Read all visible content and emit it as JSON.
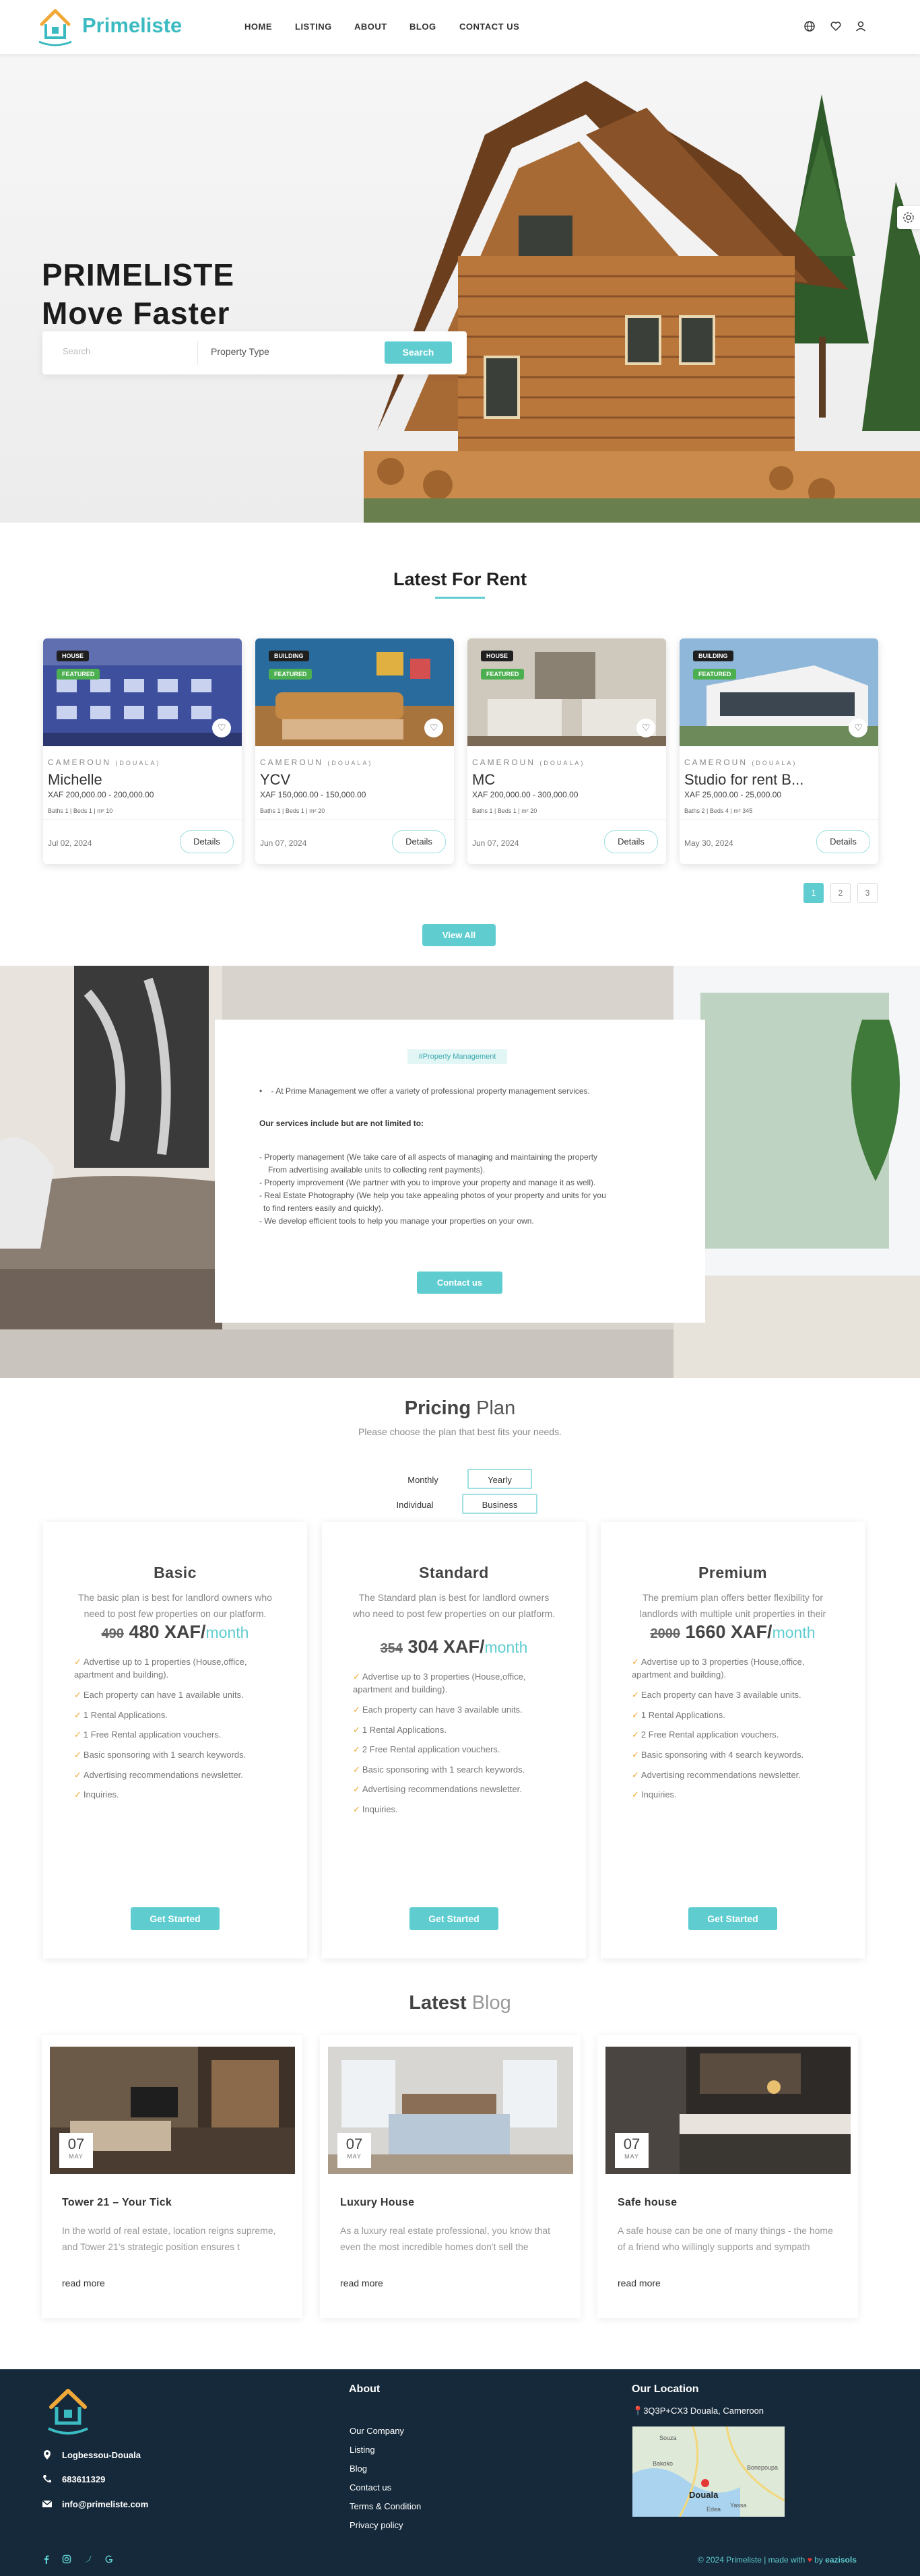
{
  "header": {
    "brand": "Primeliste",
    "nav": [
      "HOME",
      "LISTING",
      "ABOUT",
      "BLOG",
      "CONTACT US"
    ],
    "icons": [
      "globe-icon",
      "heart-icon",
      "user-icon"
    ]
  },
  "hero": {
    "title_line1": "PRIMELISTE",
    "title_line2": "Move Faster",
    "search_placeholder": "Search",
    "property_type": "Property Type",
    "search_button": "Search"
  },
  "rent": {
    "title": "Latest For Rent",
    "cards": [
      {
        "type": "HOUSE",
        "featured": "FEATURED",
        "location": "CAMEROUN",
        "city": "(DOUALA)",
        "name": "Michelle",
        "price": "XAF 200,000.00 - 200,000.00",
        "baths": "Baths 1",
        "beds": "Beds 1",
        "area": "m² 10",
        "date": "Jul 02, 2024",
        "button": "Details"
      },
      {
        "type": "BUILDING",
        "featured": "FEATURED",
        "location": "CAMEROUN",
        "city": "(DOUALA)",
        "name": "YCV",
        "price": "XAF 150,000.00 - 150,000.00",
        "baths": "Baths 1",
        "beds": "Beds 1",
        "area": "m² 20",
        "date": "Jun 07, 2024",
        "button": "Details"
      },
      {
        "type": "HOUSE",
        "featured": "FEATURED",
        "location": "CAMEROUN",
        "city": "(DOUALA)",
        "name": "MC",
        "price": "XAF 200,000.00 - 300,000.00",
        "baths": "Baths 1",
        "beds": "Beds 1",
        "area": "m² 20",
        "date": "Jun 07, 2024",
        "button": "Details"
      },
      {
        "type": "BUILDING",
        "featured": "FEATURED",
        "location": "CAMEROUN",
        "city": "(DOUALA)",
        "name": "Studio for rent B...",
        "price": "XAF 25,000.00 - 25,000.00",
        "baths": "Baths 2",
        "beds": "Beds 4",
        "area": "m² 345",
        "date": "May 30, 2024",
        "button": "Details"
      }
    ],
    "pages": [
      "1",
      "2",
      "3"
    ],
    "view_all": "View All"
  },
  "pm": {
    "tag": "#Property Management",
    "intro": "At Prime Management we offer a variety of professional property management services.",
    "heading": "Our services include but are not limited to:",
    "lines": [
      "- Property management (We take care of all aspects of managing and maintaining the property",
      "  From advertising available units to collecting rent payments).",
      "- Property improvement (We partner with you to improve your property and manage it as well).",
      "- Real Estate Photography (We help you take appealing photos of your property and units for you",
      "  to find renters easily and quickly).",
      "- We develop efficient tools to help you manage your properties on your own."
    ],
    "button": "Contact us"
  },
  "pricing": {
    "title_bold": "Pricing",
    "title_rest": " Plan",
    "subtitle": "Please choose the plan that best fits your needs.",
    "toggle_monthly": "Monthly",
    "toggle_yearly": "Yearly",
    "toggle_individual": "Individual",
    "toggle_business": "Business",
    "plans": [
      {
        "name": "Basic",
        "desc": "The basic plan is best for landlord owners who need to post few properties on our platform.",
        "old": "490",
        "price": " 480 XAF/",
        "per": "month",
        "features": [
          "Advertise up to 1 properties (House,office, apartment and building).",
          "Each property can have 1 available units.",
          "1 Rental Applications.",
          "1 Free Rental application vouchers.",
          "Basic sponsoring with 1 search keywords.",
          "Advertising recommendations newsletter.",
          "Inquiries."
        ],
        "button": "Get Started"
      },
      {
        "name": "Standard",
        "desc": "The Standard plan is best for landlord owners who need to post few properties on our platform.",
        "old": "354",
        "price": " 304 XAF/",
        "per": "month",
        "features": [
          "Advertise up to 3 properties (House,office, apartment and building).",
          "Each property can have 3 available units.",
          "1 Rental Applications.",
          "2 Free Rental application vouchers.",
          "Basic sponsoring with 1 search keywords.",
          "Advertising recommendations newsletter.",
          "Inquiries."
        ],
        "button": "Get Started"
      },
      {
        "name": "Premium",
        "desc": "The premium plan offers better flexibility for landlords with multiple unit properties in their",
        "old": "2000",
        "price": " 1660 XAF/",
        "per": "month",
        "features": [
          "Advertise up to 3 properties (House,office, apartment and building).",
          "Each property can have 3 available units.",
          "1 Rental Applications.",
          "2 Free Rental application vouchers.",
          "Basic sponsoring with 4 search keywords.",
          "Advertising recommendations newsletter.",
          "Inquiries."
        ],
        "button": "Get Started"
      }
    ]
  },
  "blog": {
    "title_bold": "Latest",
    "title_rest": " Blog",
    "posts": [
      {
        "day": "07",
        "month": "MAY",
        "title": "Tower 21 – Your Tick",
        "text": "In the world of real estate, location reigns supreme, and Tower 21's strategic position ensures t",
        "more": "read more"
      },
      {
        "day": "07",
        "month": "MAY",
        "title": "Luxury House",
        "text": "As a luxury real estate professional, you know that even the most incredible homes don't sell the",
        "more": "read more"
      },
      {
        "day": "07",
        "month": "MAY",
        "title": "Safe house",
        "text": "A safe house can be one of many things - the home of a friend who willingly supports and sympath",
        "more": "read more"
      }
    ]
  },
  "footer": {
    "address": "Logbessou-Douala",
    "phone": "683611329",
    "email": "info@primeliste.com",
    "about_title": "About",
    "links": [
      "Our Company",
      "Listing",
      "Blog",
      "Contact us",
      "Terms & Condition",
      "Privacy policy"
    ],
    "location_title": "Our Location",
    "location": "3Q3P+CX3 Douala, Cameroon",
    "map_labels": [
      "Douala",
      "Bakoko",
      "Bonepoupa",
      "Edea",
      "Souza",
      "Yassa"
    ],
    "copy_pre": "© 2024 Primeliste | made with ",
    "copy_heart": "♥",
    "copy_by": " by ",
    "copy_author": "eazisols",
    "social": [
      "facebook-icon",
      "instagram-icon",
      "twitter-icon",
      "google-icon"
    ]
  },
  "colors": {
    "accent": "#5fcdd0",
    "green_tag": "#4caf50",
    "footer": "#15293a"
  }
}
